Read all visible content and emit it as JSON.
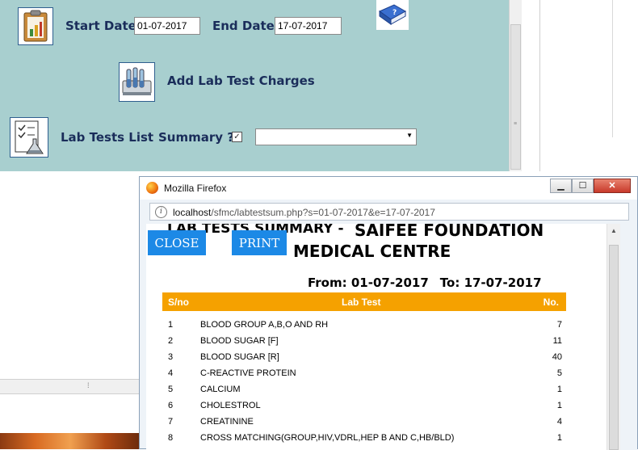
{
  "app": {
    "start_date_label": "Start Date",
    "start_date_value": "01-07-2017",
    "end_date_label": "End Date",
    "end_date_value": "17-07-2017",
    "add_lab_test_charges": "Add Lab Test Charges",
    "lab_tests_list": "Lab Tests List",
    "summary_label": "Summary ?",
    "summary_checked": true,
    "dropdown_value": ""
  },
  "popup": {
    "window_title": "Mozilla Firefox",
    "url_host": "localhost",
    "url_rest": "/sfmc/labtestsum.php?s=01-07-2017&e=17-07-2017",
    "report": {
      "title_part_a": "LAB TESTS SUMMARY -",
      "title_part_b": "SAIFEE FOUNDATION",
      "title_part_c": "MEDICAL CENTRE",
      "close_label": "CLOSE",
      "print_label": "PRINT",
      "from_text": "From: 01-07-2017",
      "to_text": "To: 17-07-2017",
      "columns": {
        "sno": "S/no",
        "test": "Lab Test",
        "no": "No."
      },
      "rows": [
        {
          "sno": "1",
          "test": "BLOOD GROUP A,B,O AND RH",
          "no": "7"
        },
        {
          "sno": "2",
          "test": "BLOOD SUGAR [F]",
          "no": "11"
        },
        {
          "sno": "3",
          "test": "BLOOD SUGAR [R]",
          "no": "40"
        },
        {
          "sno": "4",
          "test": "C-REACTIVE PROTEIN",
          "no": "5"
        },
        {
          "sno": "5",
          "test": "CALCIUM",
          "no": "1"
        },
        {
          "sno": "6",
          "test": "CHOLESTROL",
          "no": "1"
        },
        {
          "sno": "7",
          "test": "CREATININE",
          "no": "4"
        },
        {
          "sno": "8",
          "test": "CROSS MATCHING(GROUP,HIV,VDRL,HEP B AND C,HB/BLD)",
          "no": "1"
        }
      ]
    }
  },
  "colors": {
    "panel_bg": "#a8cfcf",
    "label_text": "#1a2d5a",
    "report_button": "#1c89e6",
    "header_orange": "#f5a100"
  },
  "icons": [
    "clipboard-chart-icon",
    "help-book-icon",
    "lab-tubes-icon",
    "checklist-flask-icon",
    "firefox-logo-icon",
    "info-icon"
  ]
}
